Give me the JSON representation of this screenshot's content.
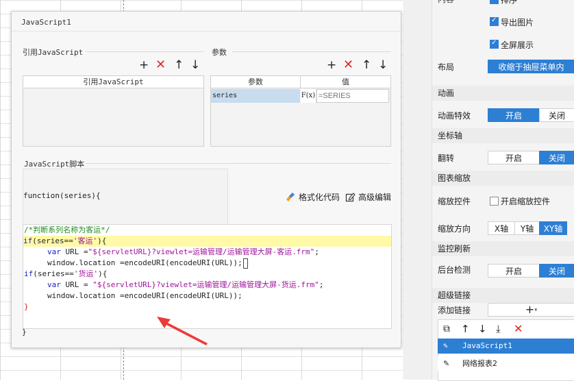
{
  "dialog": {
    "title": "JavaScript1",
    "ref_section": {
      "label": "引用JavaScript",
      "column": "引用JavaScript"
    },
    "param_section": {
      "label": "参数",
      "columns": [
        "参数",
        "值"
      ],
      "rows": [
        {
          "name": "series",
          "value_placeholder": "=SERIES"
        }
      ]
    },
    "script_section": {
      "label": "JavaScript脚本",
      "signature": "function(series){",
      "format_label": "格式化代码",
      "advanced_label": "高级编辑",
      "code": {
        "line1": "/*判断系列名称为客运*/",
        "line2_kw": "if",
        "line2_a": "(series==",
        "line2_str": "'客运'",
        "line2_b": "){",
        "line3_kw": "var",
        "line3_a": " URL =",
        "line3_str": "\"${servletURL}?viewlet=运输管理/运输管理大屏-客运.frm\"",
        "line3_b": ";",
        "line4": "window.location =encodeURI(encodeURI(URL));",
        "line5_kw": "if",
        "line5_a": "(series==",
        "line5_str": "'货运'",
        "line5_b": "){",
        "line6_kw": "var",
        "line6_a": " URL = ",
        "line6_str": "\"${servletURL}?viewlet=运输管理/运输管理大屏-货运.frm\"",
        "line6_b": ";",
        "line7": "window.location =encodeURI(encodeURI(URL));",
        "line8": "}"
      },
      "closing": "}"
    },
    "fx_label": "F(x)"
  },
  "panel": {
    "top_partial": "内容",
    "top_partial2": "排序",
    "export_image": "导出图片",
    "fullscreen": "全屏展示",
    "layout_label": "布局",
    "layout_value": "收缩于抽屉菜单内",
    "animation_head": "动画",
    "animation_effect": "动画特效",
    "on": "开启",
    "off": "关闭",
    "axis_head": "坐标轴",
    "flip": "翻转",
    "zoom_head": "图表缩放",
    "zoom_control": "缩放控件",
    "zoom_control_checkbox": "开启缩放控件",
    "zoom_direction": "缩放方向",
    "dir_x": "X轴",
    "dir_y": "Y轴",
    "dir_xy": "XY轴",
    "monitor_head": "监控刷新",
    "background_check": "后台检测",
    "hyperlink_head": "超级链接",
    "add_link": "添加链接",
    "links": [
      "JavaScript1",
      "网络报表2"
    ]
  }
}
